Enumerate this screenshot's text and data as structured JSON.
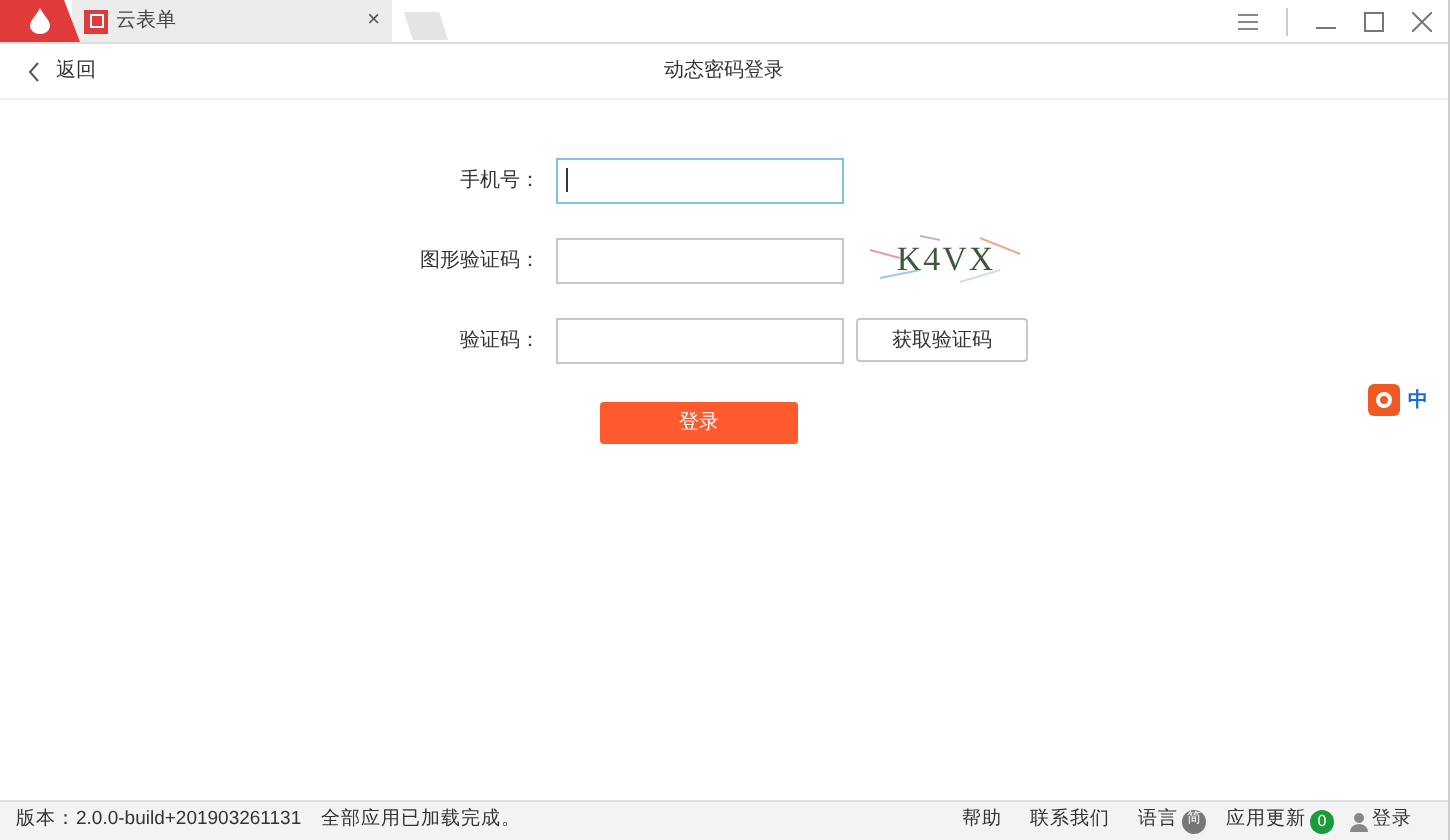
{
  "tabs": [
    {
      "title": "云表单",
      "selected": true,
      "close": "×"
    }
  ],
  "header": {
    "back": "返回",
    "title": "动态密码登录"
  },
  "form": {
    "fields": [
      {
        "label": "手机号：",
        "focused": true,
        "kind": "plain"
      },
      {
        "label": "图形验证码：",
        "focused": false,
        "kind": "captcha",
        "captcha": "K4VX"
      },
      {
        "label": "验证码：",
        "focused": false,
        "kind": "sms",
        "button": "获取验证码"
      }
    ],
    "submit": "登录"
  },
  "ime": {
    "mode": "中"
  },
  "status_bar": {
    "version": "版本：2.0.0-build+201903261131",
    "message": "全部应用已加载完成。",
    "links": [
      "帮助",
      "联系我们"
    ],
    "language": "语言",
    "language_badge": "简",
    "updates": "应用更新",
    "updates_badge": "0",
    "login": "登录"
  }
}
